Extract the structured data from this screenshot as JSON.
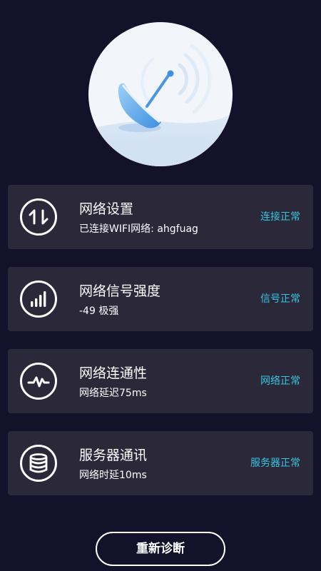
{
  "hero": {
    "icon": "satellite-dish-icon"
  },
  "cards": [
    {
      "icon": "up-down-arrows-icon",
      "title": "网络设置",
      "subtitle": "已连接WIFI网络: ahgfuag",
      "status": "连接正常"
    },
    {
      "icon": "signal-bars-icon",
      "title": "网络信号强度",
      "subtitle": "-49 极强",
      "status": "信号正常"
    },
    {
      "icon": "pulse-icon",
      "title": "网络连通性",
      "subtitle": "网络延迟75ms",
      "status": "网络正常"
    },
    {
      "icon": "database-icon",
      "title": "服务器通讯",
      "subtitle": "网络时延10ms",
      "status": "服务器正常"
    }
  ],
  "button": {
    "label": "重新诊断"
  },
  "colors": {
    "background": "#14122a",
    "card": "#2a2839",
    "status": "#37c6e2",
    "hero_bg": "#f2f5fa",
    "dish": "#5aa7ec"
  }
}
